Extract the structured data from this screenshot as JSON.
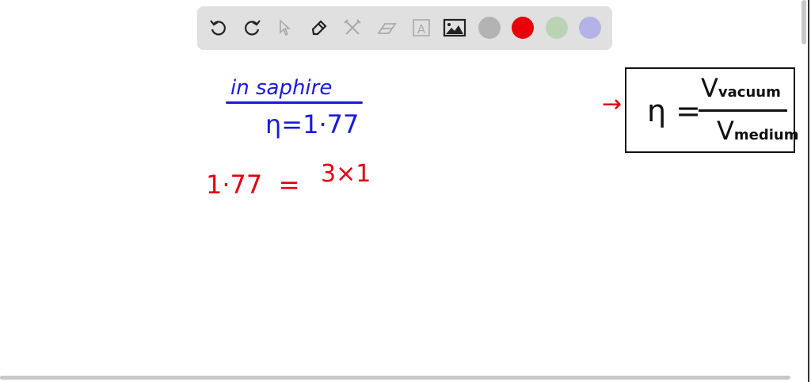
{
  "toolbar": {
    "tools": [
      "undo-icon",
      "redo-icon",
      "select-icon",
      "pen-icon",
      "tools-icon",
      "eraser-icon",
      "text-icon",
      "image-icon"
    ],
    "colors": [
      "#b3b3b3",
      "#e8000b",
      "#b9d4b4",
      "#b4b2e6"
    ],
    "text_tool_glyph": "A"
  },
  "canvas": {
    "heading": "in saphire",
    "eta_line": "η=1·77",
    "equation_left": "1·77  =",
    "equation_right": "3×1",
    "formula": {
      "lhs": "η =",
      "numerator": "V",
      "numerator_sub": "vacuum",
      "denominator": "V",
      "denominator_sub": "medium",
      "arrow": "→"
    },
    "ink_colors": {
      "blue": "#1a1adb",
      "red": "#e00012",
      "black": "#111111"
    }
  }
}
